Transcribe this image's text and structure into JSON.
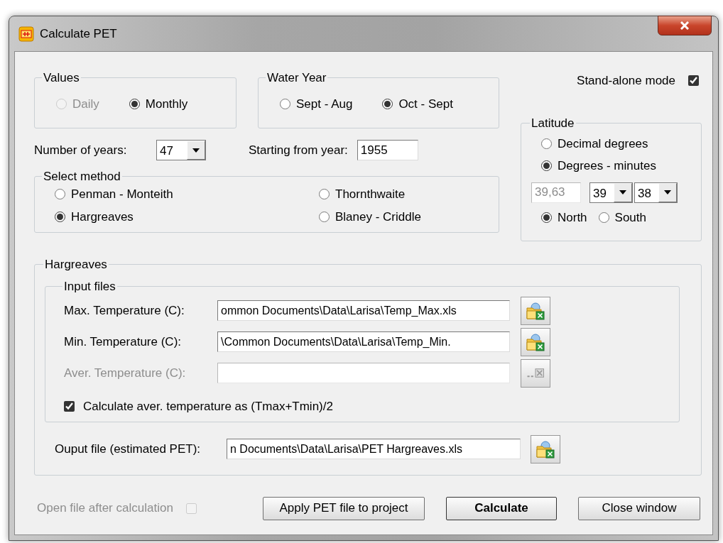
{
  "window": {
    "title": "Calculate PET"
  },
  "values": {
    "label": "Values",
    "options": [
      {
        "label": "Daily",
        "selected": false,
        "disabled": true
      },
      {
        "label": "Monthly",
        "selected": true,
        "disabled": false
      }
    ]
  },
  "water_year": {
    "label": "Water Year",
    "options": [
      {
        "label": "Sept - Aug",
        "selected": false,
        "disabled": false
      },
      {
        "label": "Oct - Sept",
        "selected": true,
        "disabled": false
      }
    ]
  },
  "stand_alone": {
    "label": "Stand-alone mode",
    "checked": true,
    "disabled": false
  },
  "number_of_years": {
    "label": "Number of years:",
    "value": "47"
  },
  "starting_year": {
    "label": "Starting from year:",
    "value": "1955"
  },
  "method": {
    "label": "Select method",
    "options": [
      {
        "label": "Penman - Monteith",
        "selected": false
      },
      {
        "label": "Thornthwaite",
        "selected": false
      },
      {
        "label": "Hargreaves",
        "selected": true
      },
      {
        "label": "Blaney - Criddle",
        "selected": false
      }
    ]
  },
  "latitude": {
    "label": "Latitude",
    "formats": [
      {
        "label": "Decimal degrees",
        "selected": false
      },
      {
        "label": "Degrees - minutes",
        "selected": true
      }
    ],
    "decimal": "39,63",
    "degrees": "39",
    "minutes": "38",
    "hemispheres": [
      {
        "label": "North",
        "selected": true
      },
      {
        "label": "South",
        "selected": false
      }
    ]
  },
  "section": {
    "label": "Hargreaves",
    "input_files": {
      "label": "Input files",
      "files": [
        {
          "label": "Max. Temperature (C):",
          "value": "ommon Documents\\Data\\Larisa\\Temp_Max.xls",
          "disabled": false
        },
        {
          "label": "Min. Temperature (C):",
          "value": "\\Common Documents\\Data\\Larisa\\Temp_Min.",
          "disabled": false
        },
        {
          "label": "Aver. Temperature (C):",
          "disabled": true
        }
      ]
    },
    "average_checkbox": {
      "label": "Calculate aver. temperature as (Tmax+Tmin)/2",
      "checked": true,
      "disabled": false
    },
    "output": {
      "label": "Ouput file (estimated PET):",
      "value": "n Documents\\Data\\Larisa\\PET Hargreaves.xls"
    }
  },
  "footer": {
    "open_after": {
      "label": "Open file after calculation",
      "checked": false,
      "disabled": true
    },
    "buttons": [
      {
        "label": "Apply PET file to project",
        "default": false
      },
      {
        "label": "Calculate",
        "default": true
      },
      {
        "label": "Close window",
        "default": false
      }
    ]
  }
}
